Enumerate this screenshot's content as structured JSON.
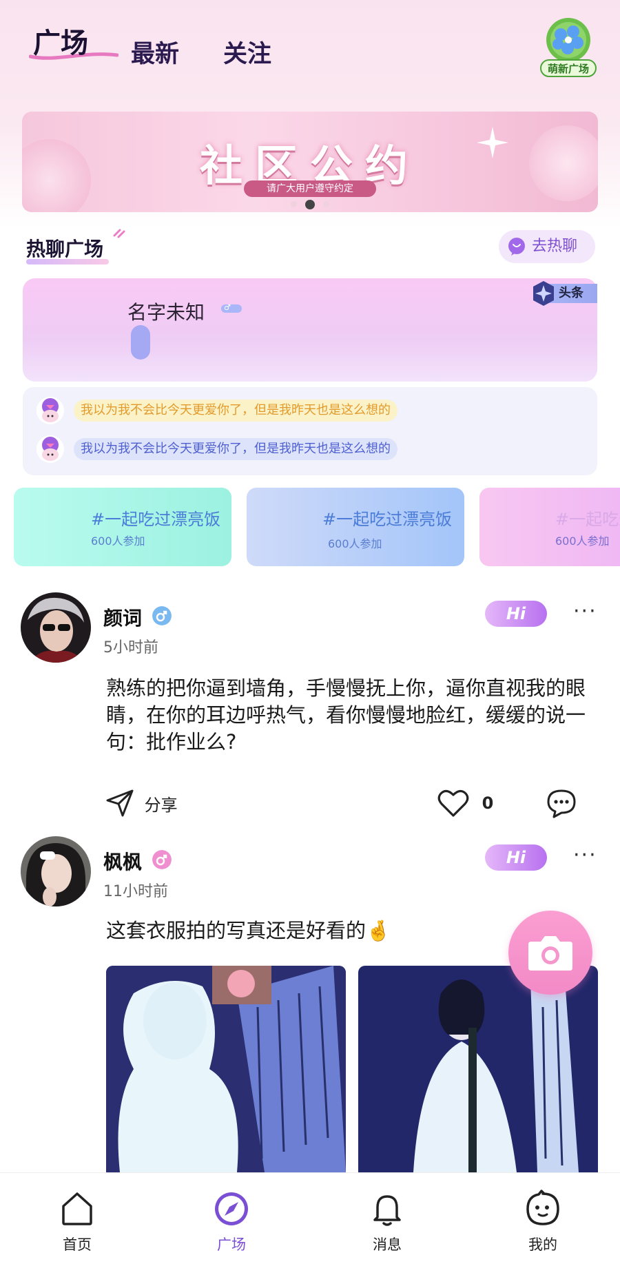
{
  "header": {
    "tabs": [
      {
        "label": "广场",
        "active": true
      },
      {
        "label": "最新",
        "active": false
      },
      {
        "label": "关注",
        "active": false
      }
    ],
    "badge_label": "萌新广场"
  },
  "banner": {
    "title": "社区公约",
    "subtitle": "请广大用户遵守约定",
    "page_dots": 3,
    "active_dot": 2
  },
  "hot_chat": {
    "section_title": "热聊广场",
    "go_button": "去热聊",
    "card": {
      "name": "名字未知",
      "tag": "头条",
      "gender": "male"
    },
    "messages": [
      {
        "text": "我以为我不会比今天更爱你了，但是我昨天也是这么想的",
        "color": "#e39a2c"
      },
      {
        "text": "我以为我不会比今天更爱你了，但是我昨天也是这么想的",
        "color": "#4e5fd0"
      }
    ]
  },
  "topics": [
    {
      "title": "#一起吃过漂亮饭",
      "count": "600人参加"
    },
    {
      "title": "#一起吃过漂亮饭",
      "count": "600人参加"
    },
    {
      "title": "#一起吃过",
      "count": "600人参加"
    }
  ],
  "posts": [
    {
      "author": "颜词",
      "gender": "male",
      "time": "5小时前",
      "hi": "Hi",
      "more": "···",
      "text": "熟练的把你逼到墙角，手慢慢抚上你，逼你直视我的眼睛，在你的耳边呼热气，看你慢慢地脸红，缓缓的说一句：批作业么?",
      "share_label": "分享",
      "likes": "0"
    },
    {
      "author": "枫枫",
      "gender": "female",
      "time": "11小时前",
      "hi": "Hi",
      "more": "···",
      "text": "这套衣服拍的写真还是好看的🤞"
    }
  ],
  "bottom_nav": [
    {
      "label": "首页",
      "icon": "home-icon",
      "active": false
    },
    {
      "label": "广场",
      "icon": "compass-icon",
      "active": true
    },
    {
      "label": "消息",
      "icon": "bell-icon",
      "active": false
    },
    {
      "label": "我的",
      "icon": "face-icon",
      "active": false
    }
  ],
  "colors": {
    "accent": "#7b4fd4",
    "hi_gradient": "#b771ef",
    "fab": "#f28ac6"
  }
}
